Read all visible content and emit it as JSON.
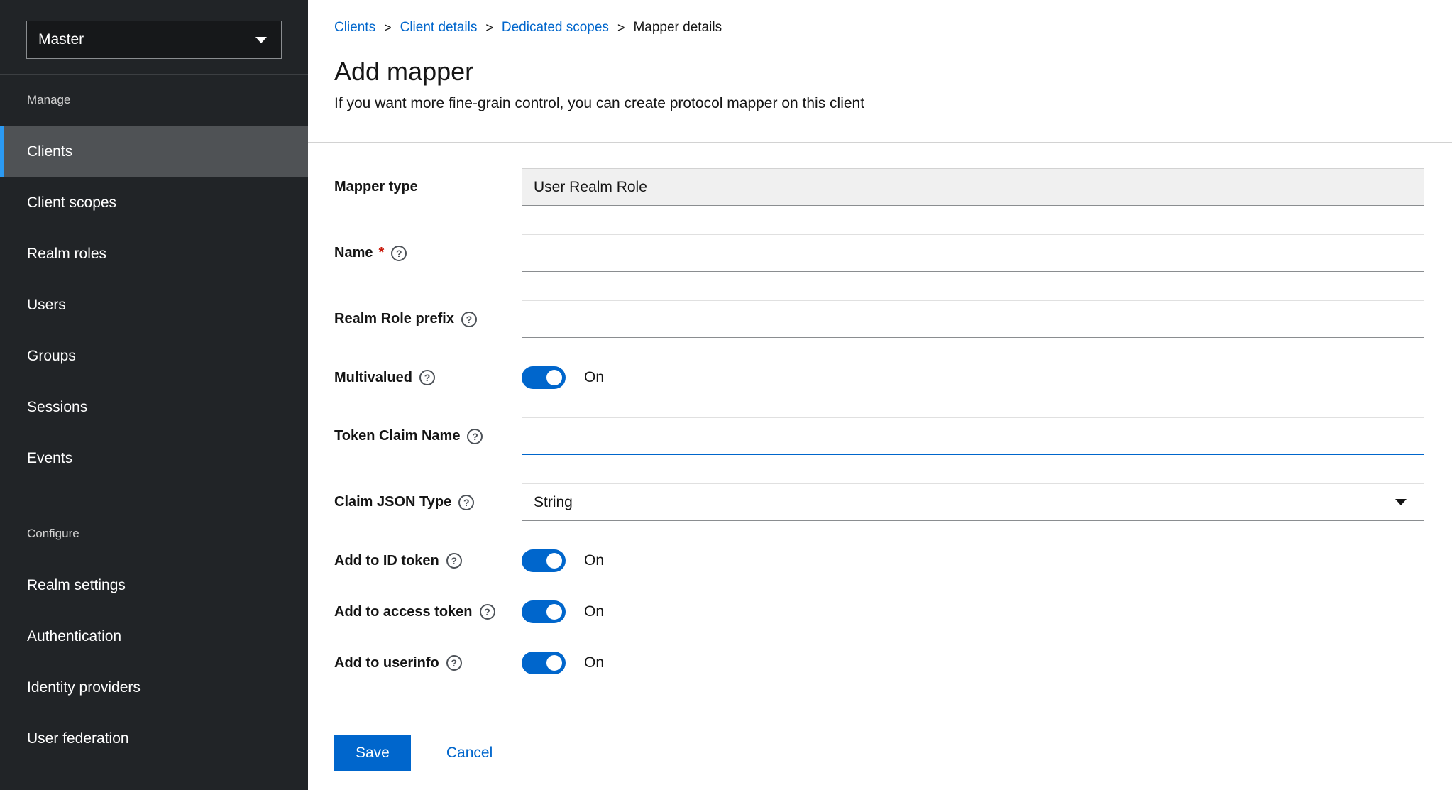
{
  "colors": {
    "accent": "#0066cc",
    "nav_active_accent": "#2b9af3",
    "sidebar_bg": "#212427",
    "sidebar_active_bg": "#4f5255",
    "danger": "#c9190b",
    "input_border_bottom": "#8a8d90",
    "readonly_bg": "#f0f0f0"
  },
  "sidebar": {
    "realm_selector": {
      "label": "Master"
    },
    "sections": [
      {
        "label": "Manage",
        "items": [
          {
            "label": "Clients",
            "active": true
          },
          {
            "label": "Client scopes",
            "active": false
          },
          {
            "label": "Realm roles",
            "active": false
          },
          {
            "label": "Users",
            "active": false
          },
          {
            "label": "Groups",
            "active": false
          },
          {
            "label": "Sessions",
            "active": false
          },
          {
            "label": "Events",
            "active": false
          }
        ]
      },
      {
        "label": "Configure",
        "items": [
          {
            "label": "Realm settings",
            "active": false
          },
          {
            "label": "Authentication",
            "active": false
          },
          {
            "label": "Identity providers",
            "active": false
          },
          {
            "label": "User federation",
            "active": false
          }
        ]
      }
    ]
  },
  "breadcrumb": {
    "separator": ">",
    "items": [
      {
        "label": "Clients",
        "current": false
      },
      {
        "label": "Client details",
        "current": false
      },
      {
        "label": "Dedicated scopes",
        "current": false
      },
      {
        "label": "Mapper details",
        "current": true
      }
    ]
  },
  "header": {
    "title": "Add mapper",
    "subtitle": "If you want more fine-grain control, you can create protocol mapper on this client"
  },
  "form": {
    "mapper_type": {
      "label": "Mapper type",
      "value": "User Realm Role"
    },
    "name": {
      "label": "Name",
      "required_indicator": "*",
      "value": ""
    },
    "realm_role_prefix": {
      "label": "Realm Role prefix",
      "value": ""
    },
    "multivalued": {
      "label": "Multivalued",
      "state": "On"
    },
    "token_claim_name": {
      "label": "Token Claim Name",
      "value": ""
    },
    "claim_json_type": {
      "label": "Claim JSON Type",
      "value": "String"
    },
    "add_to_id_token": {
      "label": "Add to ID token",
      "state": "On"
    },
    "add_to_access_token": {
      "label": "Add to access token",
      "state": "On"
    },
    "add_to_userinfo": {
      "label": "Add to userinfo",
      "state": "On"
    },
    "actions": {
      "save": "Save",
      "cancel": "Cancel"
    }
  },
  "icons": {
    "help_glyph": "?"
  }
}
